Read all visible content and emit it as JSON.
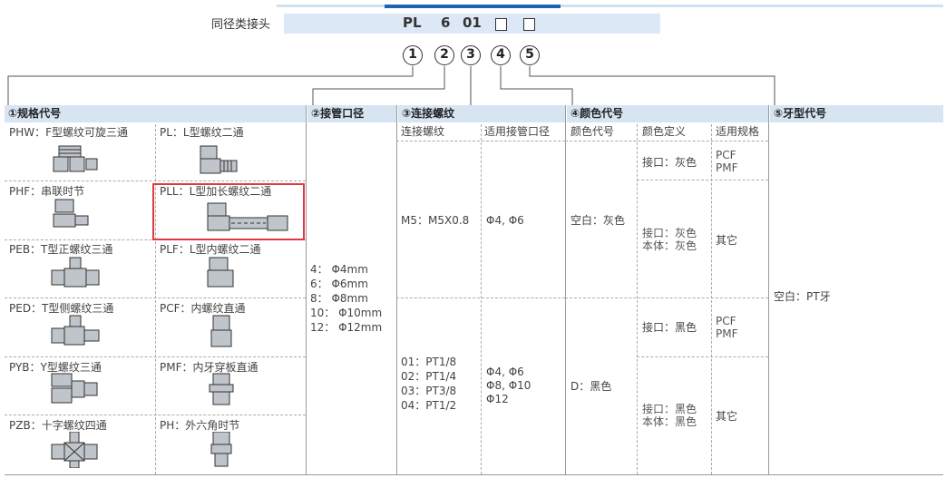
{
  "header": {
    "title": "同径类接头",
    "code": {
      "part1": "PL",
      "part2": "6",
      "part3": "01"
    },
    "circles": [
      "1",
      "2",
      "3",
      "4",
      "5"
    ]
  },
  "columns": {
    "spec": "①规格代号",
    "tube": "②接管口径",
    "thread": "③连接螺纹",
    "color": "④颜色代号",
    "tooth": "⑤牙型代号"
  },
  "spec_items": [
    {
      "label": "PHW：F型螺纹可旋三通",
      "icon": "tee-swivel-icon"
    },
    {
      "label": "PL：L型螺纹二通",
      "icon": "elbow-icon"
    },
    {
      "label": "PHF：串联时节",
      "icon": "tandem-icon"
    },
    {
      "label": "PLL：L型加长螺纹二通",
      "icon": "long-elbow-icon"
    },
    {
      "label": "PEB：T型正螺纹三通",
      "icon": "tee-icon"
    },
    {
      "label": "PLF：L型内螺纹二通",
      "icon": "female-elbow-icon"
    },
    {
      "label": "PED：T型侧螺纹三通",
      "icon": "side-tee-icon"
    },
    {
      "label": "PCF：内螺纹直通",
      "icon": "female-straight-icon"
    },
    {
      "label": "PYB：Y型螺纹三通",
      "icon": "y-tee-icon"
    },
    {
      "label": "PMF：内牙穿板直通",
      "icon": "bulkhead-icon"
    },
    {
      "label": "PZB：十字螺纹四通",
      "icon": "cross-icon"
    },
    {
      "label": "PH：外六角时节",
      "icon": "hex-icon"
    }
  ],
  "tube_sizes": [
    "4： Φ4mm",
    "6： Φ6mm",
    "8： Φ8mm",
    "10： Φ10mm",
    "12： Φ12mm"
  ],
  "thread": {
    "col_thread": "连接螺纹",
    "col_tube": "适用接管口径",
    "m5_thread": "M5：M5X0.8",
    "m5_tube": "Φ4, Φ6",
    "pt_threads": [
      "01：PT1/8",
      "02：PT1/4",
      "03：PT3/8",
      "04：PT1/2"
    ],
    "pt_tubes": [
      "Φ4, Φ6",
      "Φ8, Φ10",
      "Φ12"
    ]
  },
  "color": {
    "col_code": "颜色代号",
    "col_def": "颜色定义",
    "col_spec": "适用规格",
    "gray_code": "空白：灰色",
    "black_code": "D：黑色",
    "gray_def1": "接口：灰色",
    "gray_spec1": [
      "PCF",
      "PMF"
    ],
    "gray_def2": [
      "接口：灰色",
      "本体：灰色"
    ],
    "gray_spec2": "其它",
    "black_def1": "接口：黑色",
    "black_spec1": [
      "PCF",
      "PMF"
    ],
    "black_def2": [
      "接口：黑色",
      "本体：黑色"
    ],
    "black_spec2": "其它"
  },
  "tooth": {
    "value": "空白：PT牙"
  },
  "colors": {
    "header_bg": "#d7e5f3",
    "accent": "#1d63b4",
    "highlight": "#e0383f"
  }
}
